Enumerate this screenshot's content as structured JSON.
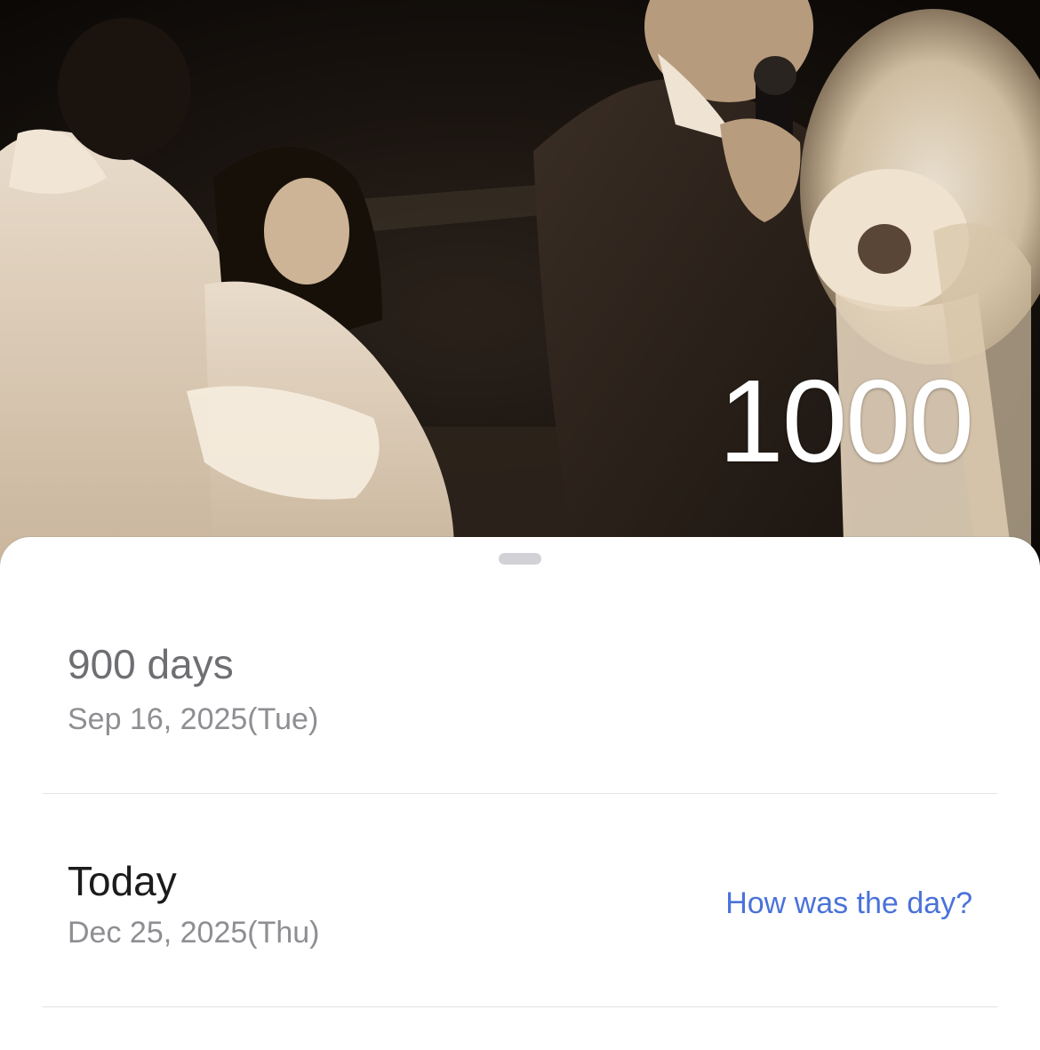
{
  "header": {
    "counter_value": "1000"
  },
  "entries": [
    {
      "title": "900 days",
      "date": "Sep 16, 2025(Tue)"
    },
    {
      "title": "Today",
      "date": "Dec 25, 2025(Thu)",
      "action_label": "How was the day?"
    }
  ],
  "colors": {
    "link": "#4a72d9",
    "subtitle": "#8e8e93",
    "divider": "#e3e3e6"
  }
}
